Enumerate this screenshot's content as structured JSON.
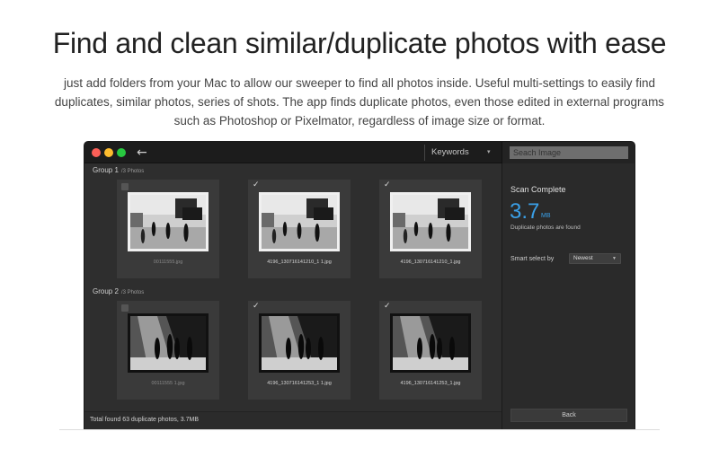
{
  "hero": {
    "title": "Find and clean similar/duplicate photos with ease",
    "description": "just add folders from your Mac to allow our sweeper to find all photos inside. Useful multi-settings to easily find duplicates, similar photos, series of shots. The app finds duplicate photos, even those edited in external programs such as Photoshop or Pixelmator, regardless of image size or format."
  },
  "toolbar": {
    "back_icon": "arrow-left-icon",
    "keywords_label": "Keywords",
    "keywords_caret": "▾",
    "search_placeholder": "Seach Image"
  },
  "groups": [
    {
      "label": "Group 1",
      "count": "/3 Photos",
      "photos": [
        {
          "filename": "00111555.jpg",
          "checked": false
        },
        {
          "filename": "4196_130716141210_1 1.jpg",
          "checked": true
        },
        {
          "filename": "4196_130716141210_1.jpg",
          "checked": true
        }
      ]
    },
    {
      "label": "Group 2",
      "count": "/3 Photos",
      "photos": [
        {
          "filename": "00111555 1.jpg",
          "checked": false
        },
        {
          "filename": "4196_130716141253_1 1.jpg",
          "checked": true
        },
        {
          "filename": "4196_130716141253_1.jpg",
          "checked": true
        }
      ]
    }
  ],
  "status": {
    "text": "Total found 63 duplicate photos, 3.7MB"
  },
  "sidebar": {
    "scan_complete": "Scan Complete",
    "size_value": "3.7",
    "size_unit": "MB",
    "found_text": "Duplicate photos are found",
    "smart_select_label": "Smart select by",
    "smart_select_value": "Newest",
    "back_label": "Back"
  },
  "colors": {
    "accent": "#3aa0e8",
    "window_bg": "#2b2b2b",
    "close": "#fc5f57",
    "minimize": "#fdbc2e",
    "zoom": "#28c840"
  }
}
